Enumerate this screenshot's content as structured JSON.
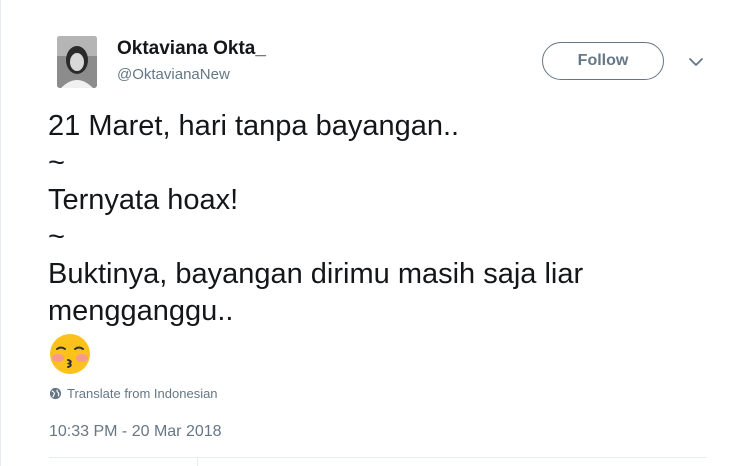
{
  "user": {
    "display_name": "Oktaviana Okta_",
    "handle": "@OktavianaNew",
    "avatar_icon": "profile-photo"
  },
  "actions": {
    "follow_label": "Follow",
    "more_icon": "chevron-down-icon"
  },
  "tweet": {
    "lines": [
      "21 Maret, hari tanpa bayangan..",
      "~",
      "Ternyata hoax!",
      "~",
      "Buktinya, bayangan dirimu masih saja liar",
      "mengganggu.."
    ],
    "emoji": "kissing-face-with-closed-eyes"
  },
  "translate": {
    "label": "Translate from Indonesian",
    "icon": "globe-icon"
  },
  "timestamp": "10:33 PM - 20 Mar 2018",
  "colors": {
    "text_primary": "#14171a",
    "text_secondary": "#657786",
    "border": "#e6ecf0"
  }
}
